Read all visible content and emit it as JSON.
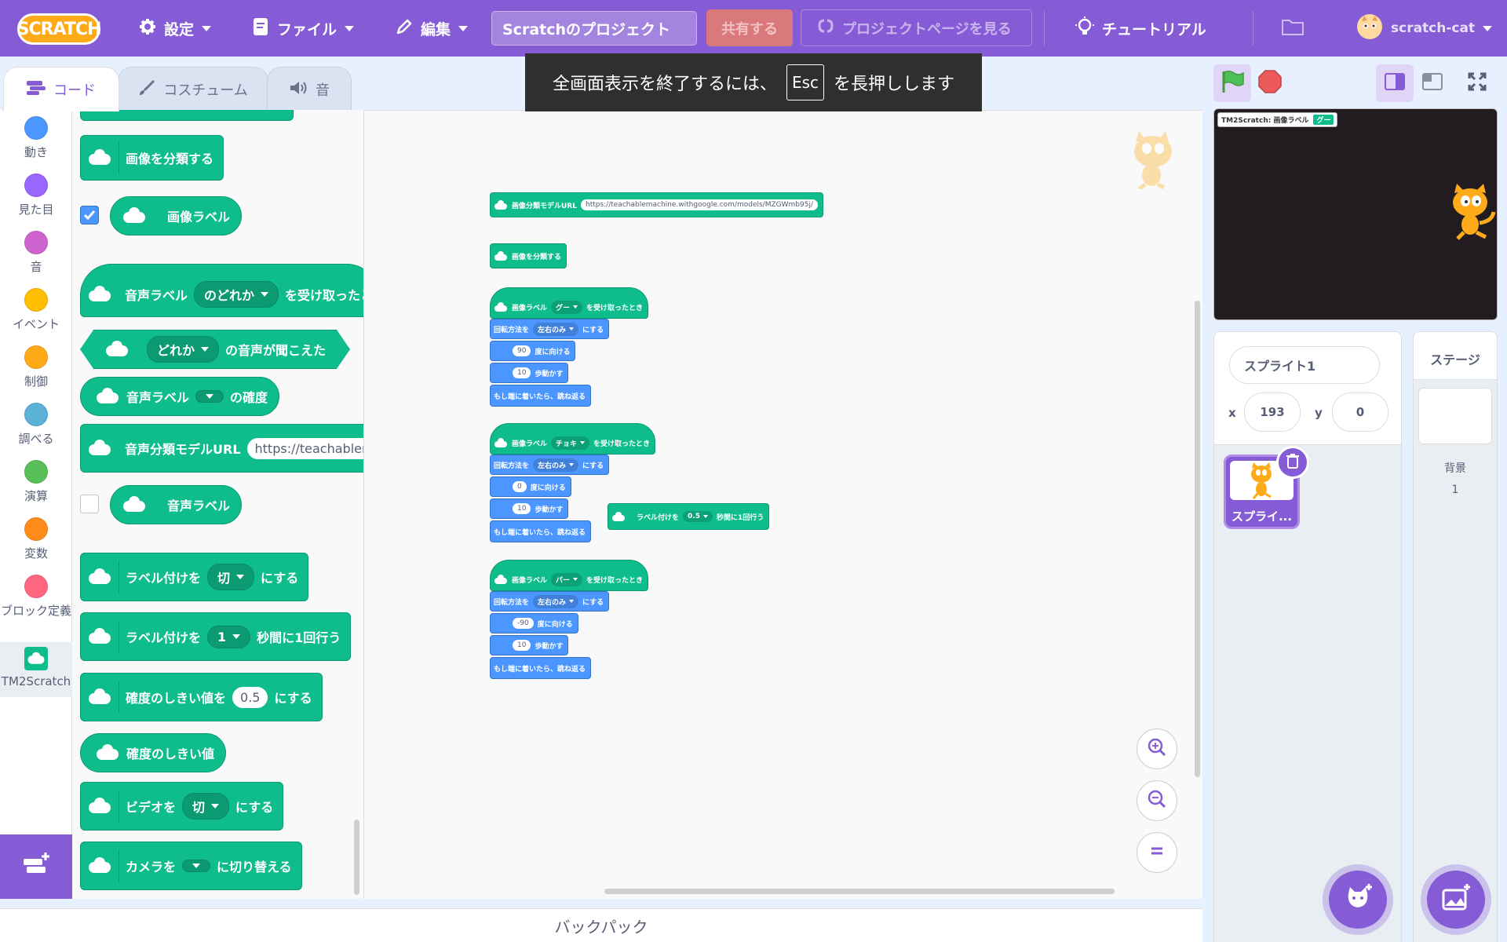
{
  "menubar": {
    "logo": "SCRATCH",
    "settings": "設定",
    "file": "ファイル",
    "edit": "編集",
    "project_title": "Scratchのプロジェクト",
    "share": "共有する",
    "see_project_page": "プロジェクトページを見る",
    "tutorials": "チュートリアル",
    "username": "scratch-cat"
  },
  "esc_banner": {
    "before": "全画面表示を終了するには、",
    "key": "Esc",
    "after": "を長押しします"
  },
  "tabs": {
    "code": "コード",
    "costumes": "コスチューム",
    "sounds": "音"
  },
  "categories": [
    {
      "label": "動き",
      "color": "#4c97ff"
    },
    {
      "label": "見た目",
      "color": "#9966ff"
    },
    {
      "label": "音",
      "color": "#cf63cf"
    },
    {
      "label": "イベント",
      "color": "#ffbf00"
    },
    {
      "label": "制御",
      "color": "#ffab19"
    },
    {
      "label": "調べる",
      "color": "#5cb1d6"
    },
    {
      "label": "演算",
      "color": "#59c059"
    },
    {
      "label": "変数",
      "color": "#ff8c1a"
    },
    {
      "label": "ブロック定義",
      "color": "#ff6680"
    },
    {
      "label": "TM2Scratch",
      "color": "#0fbd8c"
    }
  ],
  "palette": {
    "classify_image": "画像を分類する",
    "image_label": "画像ラベル",
    "sound_label_when": "音声ラベル",
    "sound_label_any": "のどれか",
    "sound_label_when_suffix": "を受け取ったとき",
    "heard_any": "どれか",
    "heard_suffix": "の音声が聞こえた",
    "sound_label_conf": "音声ラベル",
    "conf_suffix": "の確度",
    "sound_model_url": "音声分類モデルURL",
    "sound_model_url_value": "https://teachablemachine",
    "sound_label": "音声ラベル",
    "labeling_set": "ラベル付けを",
    "labeling_set_value": "切",
    "labeling_set_suffix": "にする",
    "labeling_every": "ラベル付けを",
    "labeling_every_value": "1",
    "labeling_every_suffix": "秒間に1回行う",
    "threshold_set": "確度のしきい値を",
    "threshold_value": "0.5",
    "threshold_suffix": "にする",
    "threshold": "確度のしきい値",
    "video": "ビデオを",
    "video_value": "切",
    "video_suffix": "にする",
    "camera": "カメラを",
    "camera_suffix": "に切り替える"
  },
  "workspace": {
    "model_url_label": "画像分類モデルURL",
    "model_url_value": "https://teachablemachine.withgoogle.com/models/MZGWmb95j/",
    "classify": "画像を分類する",
    "when_label": "画像ラベル",
    "when_suffix": "を受け取ったとき",
    "rotation_style": "回転方法を",
    "rotation_value": "左右のみ",
    "rotation_suffix": "にする",
    "point_suffix": "度に向ける",
    "move_suffix": "歩動かす",
    "bounce": "もし端に着いたら、跳ね返る",
    "labeling_every": "ラベル付けを",
    "labeling_every_value": "0.5",
    "labeling_every_suffix": "秒間に1回行う",
    "scripts": [
      {
        "label": "グー",
        "direction": "90",
        "steps": "10"
      },
      {
        "label": "チョキ",
        "direction": "0",
        "steps": "10"
      },
      {
        "label": "パー",
        "direction": "-90",
        "steps": "10"
      }
    ]
  },
  "backpack": "バックパック",
  "stage": {
    "monitor_label": "TM2Scratch: 画像ラベル",
    "monitor_value": "グー"
  },
  "sprite_info": {
    "name": "スプライト1",
    "x_label": "x",
    "x_value": "193",
    "y_label": "y",
    "y_value": "0",
    "thumb_label": "スプライ..."
  },
  "stage_pane": {
    "title": "ステージ",
    "backdrops_label": "背景",
    "backdrops_count": "1"
  },
  "icons": {
    "settings": "gear-icon",
    "file": "file-icon",
    "edit": "pencil-icon",
    "tutorials": "lightbulb-icon",
    "folder": "folder-icon",
    "green_flag": "green-flag-icon",
    "stop": "stop-icon",
    "zoom_in": "zoom-in-icon",
    "zoom_out": "zoom-out-icon",
    "zoom_reset": "zoom-reset-icon"
  }
}
